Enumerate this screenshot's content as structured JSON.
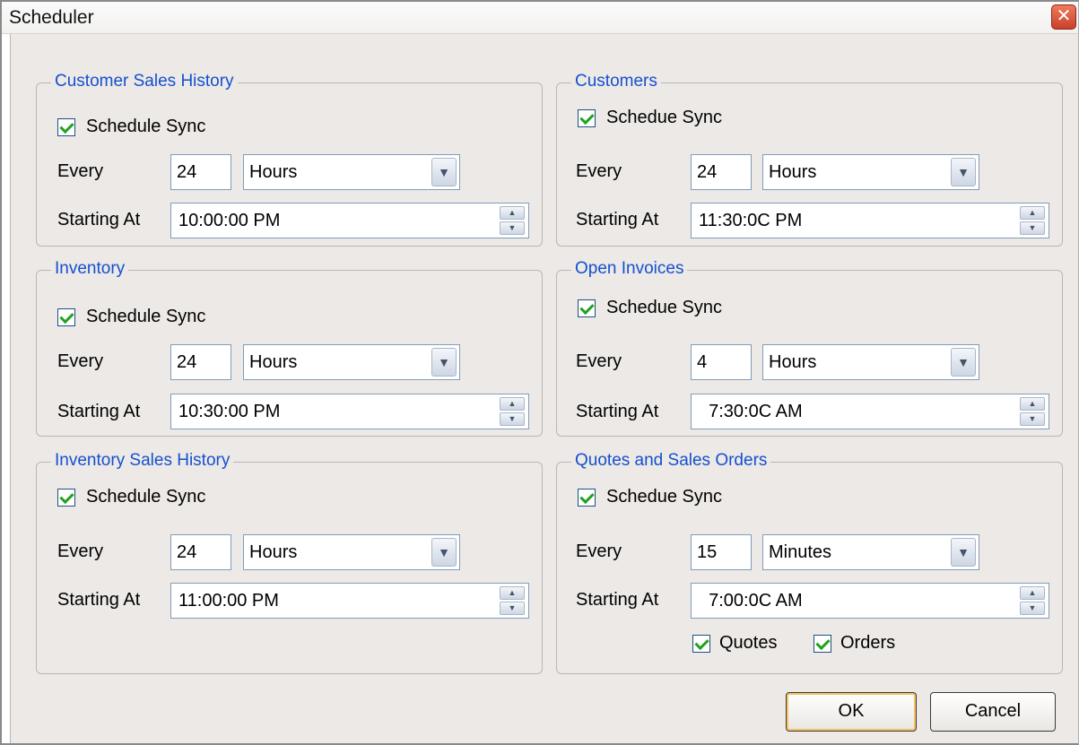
{
  "window": {
    "title": "Scheduler",
    "close_icon": "close-icon"
  },
  "labels": {
    "every": "Every",
    "starting_at": "Starting At"
  },
  "groups": [
    {
      "title": "Customer Sales History",
      "check_label": "Schedule Sync",
      "checked": true,
      "every_value": "24",
      "unit": "Hours",
      "start": "10:00:00 PM"
    },
    {
      "title": "Customers",
      "check_label": "Schedue Sync",
      "checked": true,
      "every_value": "24",
      "unit": "Hours",
      "start": "11:30:0C PM"
    },
    {
      "title": "Inventory",
      "check_label": "Schedule Sync",
      "checked": true,
      "every_value": "24",
      "unit": "Hours",
      "start": "10:30:00 PM"
    },
    {
      "title": "Open Invoices",
      "check_label": "Schedue Sync",
      "checked": true,
      "every_value": "4",
      "unit": "Hours",
      "start": "  7:30:0C AM"
    },
    {
      "title": "Inventory Sales History",
      "check_label": "Schedule Sync",
      "checked": true,
      "every_value": "24",
      "unit": "Hours",
      "start": "11:00:00 PM"
    },
    {
      "title": "Quotes and Sales Orders",
      "check_label": "Schedue Sync",
      "checked": true,
      "every_value": "15",
      "unit": "Minutes",
      "start": "  7:00:0C AM"
    }
  ],
  "extra_checks": [
    {
      "label": "Quotes",
      "checked": true
    },
    {
      "label": "Orders",
      "checked": true
    }
  ],
  "buttons": {
    "ok": "OK",
    "cancel": "Cancel"
  },
  "colors": {
    "legend": "#1550d0",
    "check": "#21a121",
    "background": "#ece9e6"
  }
}
